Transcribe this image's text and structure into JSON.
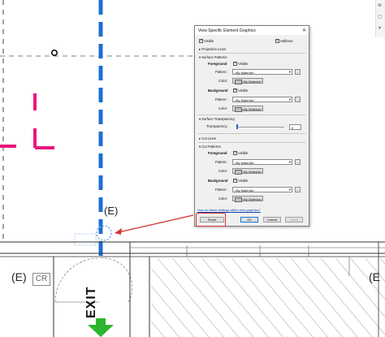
{
  "dialog": {
    "title": "View Specific Element Graphics",
    "visible_label": "Visible",
    "halftone_label": "Halftone",
    "sections": {
      "projection_lines": "Projection Lines",
      "surface_patterns": "Surface Patterns",
      "surface_transparency": "Surface Transparency",
      "cut_lines": "Cut Lines",
      "cut_patterns": "Cut Patterns"
    },
    "surface": {
      "foreground_label": "Foreground",
      "foreground_visible_label": "Visible",
      "pattern_label": "Pattern:",
      "pattern_value": "<By Material>",
      "color_label": "Color:",
      "color_value": "<By Material>",
      "background_label": "Background",
      "background_visible_label": "Visible",
      "bg_pattern_label": "Pattern:",
      "bg_pattern_value": "<By Material>",
      "bg_color_label": "Color:",
      "bg_color_value": "<By Material>"
    },
    "transparency": {
      "label": "Transparency:",
      "value": "0"
    },
    "cut": {
      "foreground_label": "Foreground",
      "foreground_visible_label": "Visible",
      "pattern_label": "Pattern:",
      "pattern_value": "<By Material>",
      "color_label": "Color:",
      "color_value": "<By Material>",
      "background_label": "Background",
      "background_visible_label": "Visible",
      "bg_pattern_label": "Pattern:",
      "bg_pattern_value": "<By Material>",
      "bg_color_label": "Color:",
      "bg_color_value": "<By Material>"
    },
    "help_link": "How do these settings affect view graphics?",
    "buttons": {
      "reset": "Reset",
      "ok": "OK",
      "cancel": "Cancel",
      "apply": "Apply"
    }
  },
  "drawing": {
    "label_e_top": "(E)",
    "label_e_left": "(E)",
    "label_e_right": "(E",
    "label_cr": "CR",
    "label_exit": "EXIT"
  },
  "colors": {
    "gridline_blue": "#1f6fd1",
    "magenta": "#e8177b",
    "exit_green": "#2db52d",
    "highlight_red": "#d33333",
    "accent_blue": "#1e6fd6"
  }
}
